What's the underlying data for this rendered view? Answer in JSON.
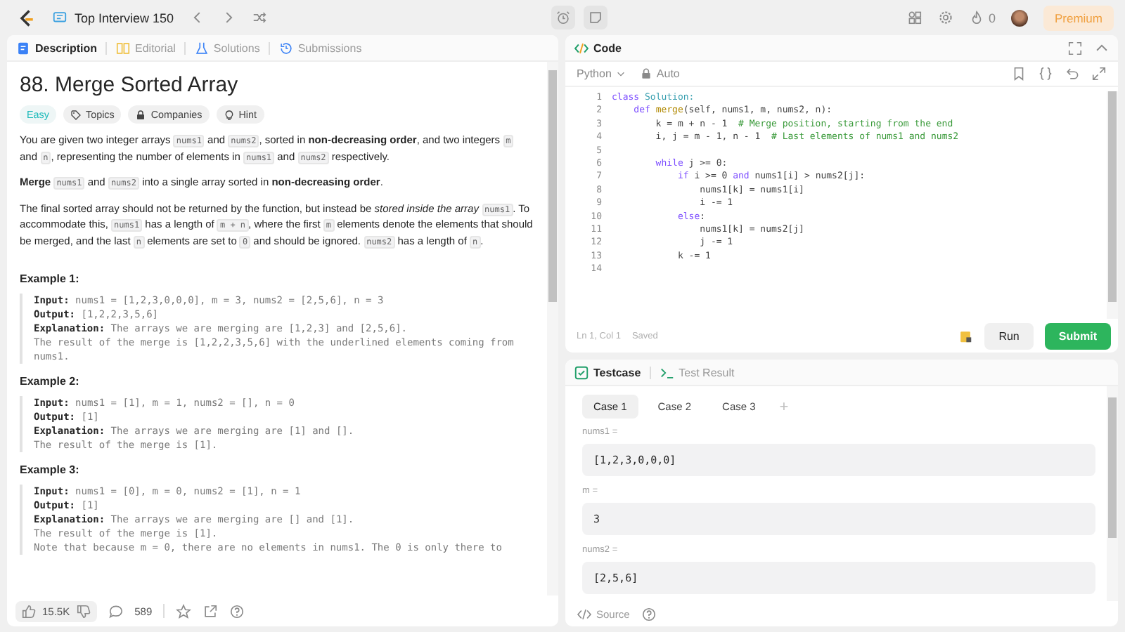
{
  "top_bar": {
    "list_title": "Top Interview 150",
    "streak_count": "0",
    "premium_label": "Premium"
  },
  "description_panel": {
    "tabs": [
      {
        "label": "Description",
        "selected": true
      },
      {
        "label": "Editorial",
        "selected": false
      },
      {
        "label": "Solutions",
        "selected": false
      },
      {
        "label": "Submissions",
        "selected": false
      }
    ],
    "title": "88. Merge Sorted Array",
    "tags": [
      {
        "kind": "difficulty",
        "label": "Easy"
      },
      {
        "kind": "topics",
        "label": "Topics"
      },
      {
        "kind": "companies",
        "label": "Companies"
      },
      {
        "kind": "hint",
        "label": "Hint"
      }
    ],
    "paragraphs": [
      [
        {
          "kind": "text",
          "text": "You are given two integer arrays "
        },
        {
          "kind": "code",
          "text": "nums1"
        },
        {
          "kind": "text",
          "text": " and "
        },
        {
          "kind": "code",
          "text": "nums2"
        },
        {
          "kind": "text",
          "text": ", sorted in "
        },
        {
          "kind": "bold",
          "text": "non-decreasing order"
        },
        {
          "kind": "text",
          "text": ", and two integers "
        },
        {
          "kind": "code",
          "text": "m"
        },
        {
          "kind": "text",
          "text": " and "
        },
        {
          "kind": "code",
          "text": "n"
        },
        {
          "kind": "text",
          "text": ", representing the number of elements in "
        },
        {
          "kind": "code",
          "text": "nums1"
        },
        {
          "kind": "text",
          "text": " and "
        },
        {
          "kind": "code",
          "text": "nums2"
        },
        {
          "kind": "text",
          "text": " respectively."
        }
      ],
      [
        {
          "kind": "bold",
          "text": "Merge "
        },
        {
          "kind": "code",
          "text": "nums1"
        },
        {
          "kind": "text",
          "text": " and "
        },
        {
          "kind": "code",
          "text": "nums2"
        },
        {
          "kind": "text",
          "text": " into a single array sorted in "
        },
        {
          "kind": "bold",
          "text": "non-decreasing order"
        },
        {
          "kind": "text",
          "text": "."
        }
      ],
      [
        {
          "kind": "text",
          "text": "The final sorted array should not be returned by the function, but instead be "
        },
        {
          "kind": "italic",
          "text": "stored inside the array "
        },
        {
          "kind": "code",
          "text": "nums1"
        },
        {
          "kind": "text",
          "text": ". To accommodate this, "
        },
        {
          "kind": "code",
          "text": "nums1"
        },
        {
          "kind": "text",
          "text": " has a length of "
        },
        {
          "kind": "code",
          "text": "m + n"
        },
        {
          "kind": "text",
          "text": ", where the first "
        },
        {
          "kind": "code",
          "text": "m"
        },
        {
          "kind": "text",
          "text": " elements denote the elements that should be merged, and the last "
        },
        {
          "kind": "code",
          "text": "n"
        },
        {
          "kind": "text",
          "text": " elements are set to "
        },
        {
          "kind": "code",
          "text": "0"
        },
        {
          "kind": "text",
          "text": " and should be ignored. "
        },
        {
          "kind": "code",
          "text": "nums2"
        },
        {
          "kind": "text",
          "text": " has a length of "
        },
        {
          "kind": "code",
          "text": "n"
        },
        {
          "kind": "text",
          "text": "."
        }
      ]
    ],
    "examples": [
      {
        "title": "Example 1:",
        "lines": [
          {
            "label": "Input:",
            "text": "nums1 = [1,2,3,0,0,0], m = 3, nums2 = [2,5,6], n = 3"
          },
          {
            "label": "Output:",
            "text": "[1,2,2,3,5,6]"
          },
          {
            "label": "Explanation:",
            "text": "The arrays we are merging are [1,2,3] and [2,5,6]."
          },
          {
            "text": "The result of the merge is [1,2,2,3,5,6] with the underlined elements coming from nums1."
          }
        ]
      },
      {
        "title": "Example 2:",
        "lines": [
          {
            "label": "Input:",
            "text": "nums1 = [1], m = 1, nums2 = [], n = 0"
          },
          {
            "label": "Output:",
            "text": "[1]"
          },
          {
            "label": "Explanation:",
            "text": "The arrays we are merging are [1] and []."
          },
          {
            "text": "The result of the merge is [1]."
          }
        ]
      },
      {
        "title": "Example 3:",
        "lines": [
          {
            "label": "Input:",
            "text": "nums1 = [0], m = 0, nums2 = [1], n = 1"
          },
          {
            "label": "Output:",
            "text": "[1]"
          },
          {
            "label": "Explanation:",
            "text": "The arrays we are merging are [] and [1]."
          },
          {
            "text": "The result of the merge is [1]."
          },
          {
            "text": "Note that because m = 0, there are no elements in nums1. The 0 is only there to"
          }
        ]
      }
    ],
    "footer": {
      "likes": "15.5K",
      "comments": "589"
    }
  },
  "code_panel": {
    "title": "Code",
    "language": "Python",
    "mode": "Auto",
    "lines": [
      {
        "number": "1",
        "tokens": [
          {
            "kind": "keyword",
            "text": "class"
          },
          {
            "kind": "class",
            "text": " Solution:"
          }
        ]
      },
      {
        "number": "2",
        "tokens": [
          {
            "kind": "keyword",
            "text": "    def"
          },
          {
            "kind": "function",
            "text": " merge"
          },
          {
            "kind": "plain",
            "text": "(self, nums1, m, nums2, n):"
          }
        ]
      },
      {
        "number": "3",
        "tokens": [
          {
            "kind": "plain",
            "text": "        k = m + n - 1  "
          },
          {
            "kind": "comment",
            "text": "# Merge position, starting from the end"
          }
        ]
      },
      {
        "number": "4",
        "tokens": [
          {
            "kind": "plain",
            "text": "        i, j = m - 1, n - 1  "
          },
          {
            "kind": "comment",
            "text": "# Last elements of nums1 and nums2"
          }
        ]
      },
      {
        "number": "5"
      },
      {
        "number": "6",
        "tokens": [
          {
            "kind": "keyword",
            "text": "        while"
          },
          {
            "kind": "plain",
            "text": " j >= 0:"
          }
        ]
      },
      {
        "number": "7",
        "tokens": [
          {
            "kind": "keyword",
            "text": "            if"
          },
          {
            "kind": "plain",
            "text": " i >= 0 "
          },
          {
            "kind": "keyword",
            "text": "and"
          },
          {
            "kind": "plain",
            "text": " nums1[i] > nums2[j]:"
          }
        ]
      },
      {
        "number": "8",
        "tokens": [
          {
            "kind": "plain",
            "text": "                nums1[k] = nums1[i]"
          }
        ]
      },
      {
        "number": "9",
        "tokens": [
          {
            "kind": "plain",
            "text": "                i -= 1"
          }
        ]
      },
      {
        "number": "10",
        "tokens": [
          {
            "kind": "keyword",
            "text": "            else"
          },
          {
            "kind": "plain",
            "text": ":"
          }
        ]
      },
      {
        "number": "11",
        "tokens": [
          {
            "kind": "plain",
            "text": "                nums1[k] = nums2[j]"
          }
        ]
      },
      {
        "number": "12",
        "tokens": [
          {
            "kind": "plain",
            "text": "                j -= 1"
          }
        ]
      },
      {
        "number": "13",
        "tokens": [
          {
            "kind": "plain",
            "text": "            k -= 1"
          }
        ]
      },
      {
        "number": "14"
      }
    ],
    "cursor": "Ln 1, Col 1",
    "save_state": "Saved",
    "run_label": "Run",
    "submit_label": "Submit"
  },
  "test_panel": {
    "tabs": [
      {
        "label": "Testcase",
        "selected": true
      },
      {
        "label": "Test Result",
        "selected": false
      }
    ],
    "cases": [
      {
        "label": "Case 1",
        "selected": true
      },
      {
        "label": "Case 2",
        "selected": false
      },
      {
        "label": "Case 3",
        "selected": false
      }
    ],
    "add_label": "+",
    "inputs": [
      {
        "label": "nums1 =",
        "value": "[1,2,3,0,0,0]"
      },
      {
        "label": "m =",
        "value": "3"
      },
      {
        "label": "nums2 =",
        "value": "[2,5,6]"
      }
    ],
    "source_label": "Source"
  }
}
